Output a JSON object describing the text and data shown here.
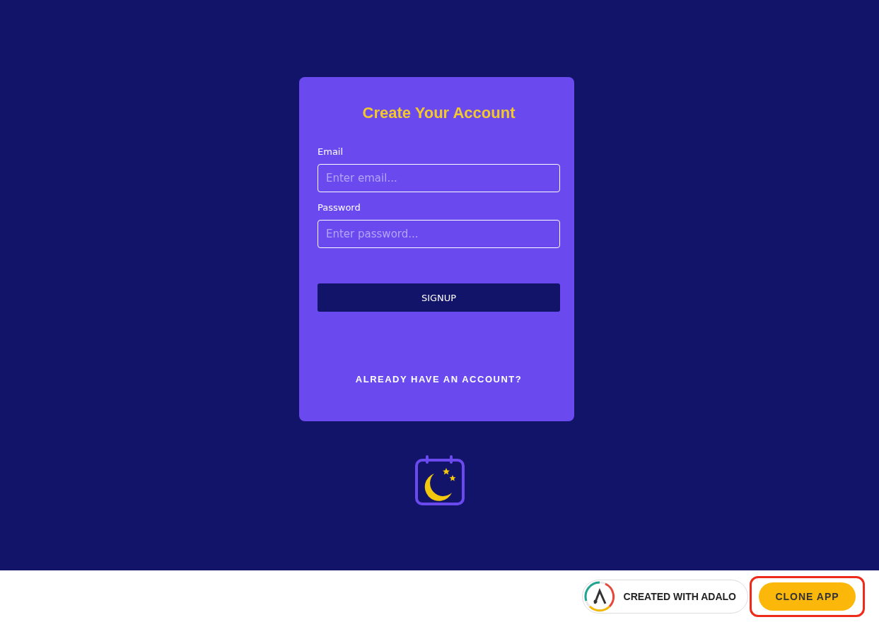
{
  "signup_card": {
    "title": "Create Your Account",
    "fields": [
      {
        "label": "Email",
        "placeholder": "Enter email..."
      },
      {
        "label": "Password",
        "placeholder": "Enter password..."
      }
    ],
    "button": "SIGNUP",
    "login_link": "ALREADY HAVE AN ACCOUNT?"
  },
  "footer": {
    "badge": "CREATED WITH ADALO",
    "clone_button": "CLONE APP"
  }
}
